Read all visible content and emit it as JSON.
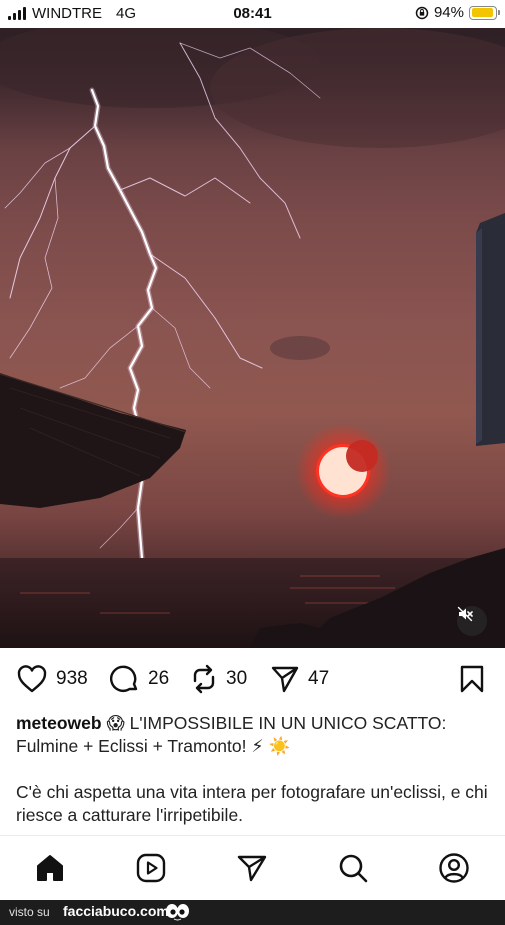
{
  "status_bar": {
    "carrier": "WINDTRE",
    "network": "4G",
    "time": "08:41",
    "battery_percent": "94%",
    "battery_level": 0.94,
    "icons": [
      "signal-icon",
      "orientation-lock-icon",
      "battery-icon"
    ]
  },
  "media": {
    "description_icons": [
      "mute-icon"
    ]
  },
  "actions": {
    "likes": "938",
    "comments": "26",
    "reposts": "30",
    "shares": "47",
    "icons": [
      "heart-icon",
      "comment-icon",
      "repost-icon",
      "send-icon",
      "bookmark-icon"
    ]
  },
  "caption": {
    "username": "meteoweb",
    "line1_text": "L'IMPOSSIBILE IN UN UNICO SCATTO: Fulmine + Eclissi + Tramonto!",
    "emojis": [
      "😱",
      "⚡",
      "☀️"
    ],
    "paragraph2": "C'è chi aspetta una vita intera per fotografare un'eclissi, e chi riesce a catturare l'irripetibile."
  },
  "bottom_nav": {
    "items": [
      "home-icon",
      "reels-icon",
      "send-icon",
      "search-icon",
      "profile-icon"
    ]
  },
  "footer": {
    "prefix": "visto su",
    "brand": "facciabuco.com"
  },
  "colors": {
    "accent_battery": "#f2c500",
    "footer_bg": "#1d1d1d",
    "sun_core": "#ffd9c8",
    "sun_glow": "#ff2a1a"
  }
}
